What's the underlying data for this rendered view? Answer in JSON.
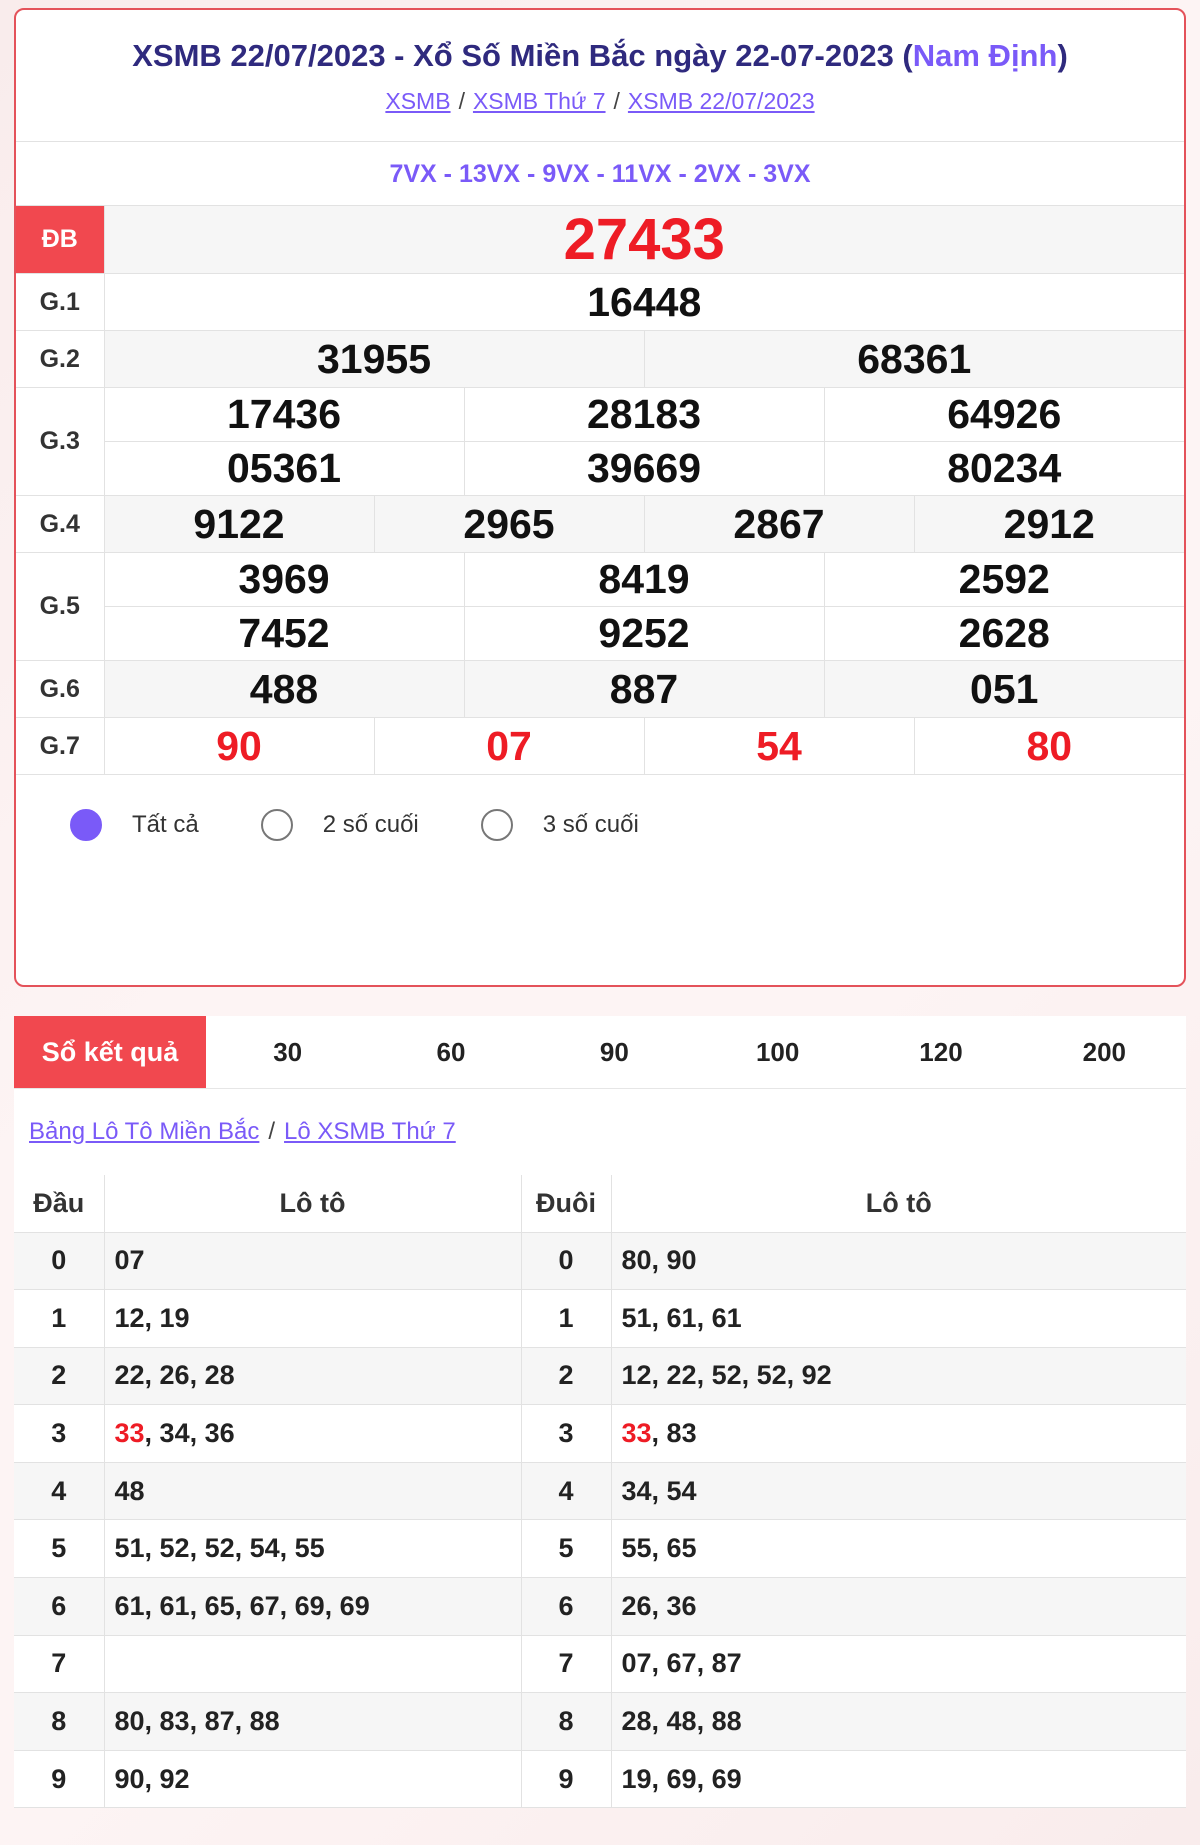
{
  "header": {
    "title_main": "XSMB 22/07/2023 - Xổ Số Miền Bắc ngày 22-07-2023 (",
    "title_province": "Nam Định",
    "title_close": ")",
    "breadcrumbs": [
      "XSMB",
      "XSMB Thứ 7",
      "XSMB 22/07/2023"
    ],
    "breadcrumb_sep": "/"
  },
  "codes": "7VX - 13VX - 9VX - 11VX - 2VX - 3VX",
  "prizes": {
    "db": {
      "label": "ĐB",
      "numbers": [
        "27433"
      ]
    },
    "g1": {
      "label": "G.1",
      "numbers": [
        "16448"
      ]
    },
    "g2": {
      "label": "G.2",
      "numbers": [
        "31955",
        "68361"
      ]
    },
    "g3": {
      "label": "G.3",
      "numbers": [
        "17436",
        "28183",
        "64926",
        "05361",
        "39669",
        "80234"
      ]
    },
    "g4": {
      "label": "G.4",
      "numbers": [
        "9122",
        "2965",
        "2867",
        "2912"
      ]
    },
    "g5": {
      "label": "G.5",
      "numbers": [
        "3969",
        "8419",
        "2592",
        "7452",
        "9252",
        "2628"
      ]
    },
    "g6": {
      "label": "G.6",
      "numbers": [
        "488",
        "887",
        "051"
      ]
    },
    "g7": {
      "label": "G.7",
      "numbers": [
        "90",
        "07",
        "54",
        "80"
      ]
    }
  },
  "filters": {
    "options": [
      "Tất cả",
      "2 số cuối",
      "3 số cuối"
    ],
    "selected": "Tất cả"
  },
  "tabs": {
    "active_label": "Sổ kết quả",
    "items": [
      "30",
      "60",
      "90",
      "100",
      "120",
      "200"
    ]
  },
  "loto_links": [
    "Bảng Lô Tô Miền Bắc",
    "Lô XSMB Thứ 7"
  ],
  "loto_table": {
    "headers": [
      "Đầu",
      "Lô tô",
      "Đuôi",
      "Lô tô"
    ],
    "rows": [
      {
        "dau": "0",
        "dau_loto_hl": "",
        "dau_loto": "07",
        "duoi": "0",
        "duoi_loto_hl": "",
        "duoi_loto": "80, 90"
      },
      {
        "dau": "1",
        "dau_loto_hl": "",
        "dau_loto": "12, 19",
        "duoi": "1",
        "duoi_loto_hl": "",
        "duoi_loto": "51, 61, 61"
      },
      {
        "dau": "2",
        "dau_loto_hl": "",
        "dau_loto": "22, 26, 28",
        "duoi": "2",
        "duoi_loto_hl": "",
        "duoi_loto": "12, 22, 52, 52, 92"
      },
      {
        "dau": "3",
        "dau_loto_hl": "33",
        "dau_loto": ", 34, 36",
        "duoi": "3",
        "duoi_loto_hl": "33",
        "duoi_loto": ", 83"
      },
      {
        "dau": "4",
        "dau_loto_hl": "",
        "dau_loto": "48",
        "duoi": "4",
        "duoi_loto_hl": "",
        "duoi_loto": "34, 54"
      },
      {
        "dau": "5",
        "dau_loto_hl": "",
        "dau_loto": "51, 52, 52, 54, 55",
        "duoi": "5",
        "duoi_loto_hl": "",
        "duoi_loto": "55, 65"
      },
      {
        "dau": "6",
        "dau_loto_hl": "",
        "dau_loto": "61, 61, 65, 67, 69, 69",
        "duoi": "6",
        "duoi_loto_hl": "",
        "duoi_loto": "26, 36"
      },
      {
        "dau": "7",
        "dau_loto_hl": "",
        "dau_loto": "",
        "duoi": "7",
        "duoi_loto_hl": "",
        "duoi_loto": "07, 67, 87"
      },
      {
        "dau": "8",
        "dau_loto_hl": "",
        "dau_loto": "80, 83, 87, 88",
        "duoi": "8",
        "duoi_loto_hl": "",
        "duoi_loto": "28, 48, 88"
      },
      {
        "dau": "9",
        "dau_loto_hl": "",
        "dau_loto": "90, 92",
        "duoi": "9",
        "duoi_loto_hl": "",
        "duoi_loto": "19, 69, 69"
      }
    ]
  },
  "colors": {
    "accent_red": "#f1484f",
    "number_red": "#ee1c25",
    "purple": "#7a5af8",
    "title_navy": "#2f2a7e"
  }
}
